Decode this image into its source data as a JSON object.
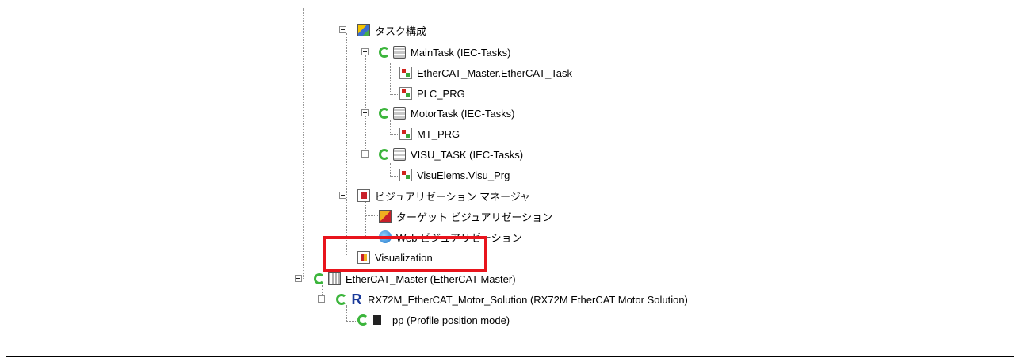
{
  "tree": {
    "task_config": "タスク構成",
    "main_task": "MainTask (IEC-Tasks)",
    "ethercat_task": "EtherCAT_Master.EtherCAT_Task",
    "plc_prg": "PLC_PRG",
    "motor_task": "MotorTask (IEC-Tasks)",
    "mt_prg": "MT_PRG",
    "visu_task": "VISU_TASK (IEC-Tasks)",
    "visu_prg": "VisuElems.Visu_Prg",
    "visu_manager": "ビジュアリゼーション マネージャ",
    "target_visu": "ターゲット ビジュアリゼーション",
    "web_visu": "Web ビジュアリゼーション",
    "visualization": "Visualization",
    "ethercat_master": "EtherCAT_Master (EtherCAT Master)",
    "rx72m": "RX72M_EtherCAT_Motor_Solution (RX72M EtherCAT Motor Solution)",
    "pp": "pp (Profile position mode)"
  },
  "icons": {
    "task_config": "task-config-icon",
    "task_status": "refresh-icon",
    "task": "task-stack-icon",
    "program": "program-icon",
    "visu_manager": "visualization-manager-icon",
    "target_visu": "target-visualization-icon",
    "web_visu": "web-visualization-icon",
    "visualization": "visualization-icon",
    "ethercat_master": "ethercat-master-icon",
    "rx72m": "r-logo-icon",
    "pp": "profile-mode-icon"
  },
  "colors": {
    "highlight": "#e8141c",
    "status_green": "#3cb53c"
  }
}
